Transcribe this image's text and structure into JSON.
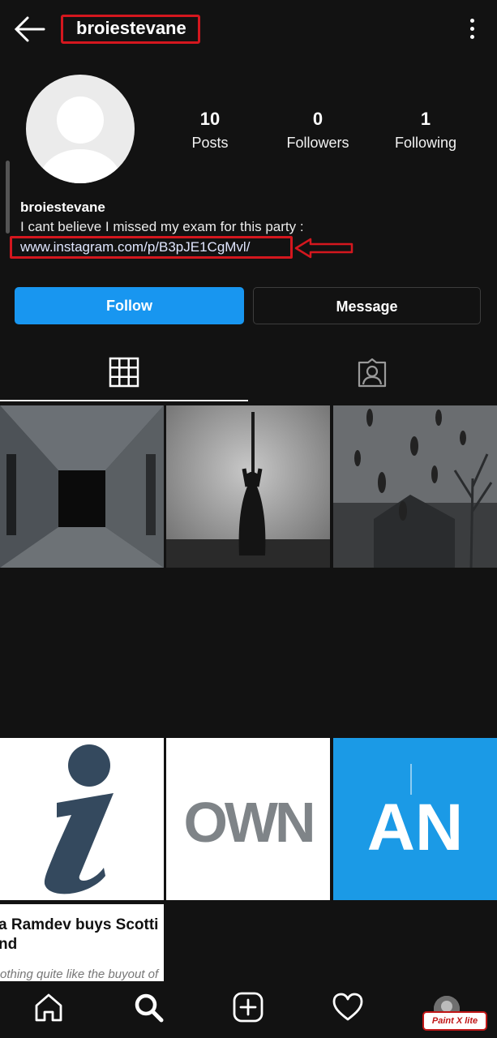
{
  "header": {
    "username": "broiestevane"
  },
  "stats": [
    {
      "value": "10",
      "label": "Posts"
    },
    {
      "value": "0",
      "label": "Followers"
    },
    {
      "value": "1",
      "label": "Following"
    }
  ],
  "bio": {
    "name": "broiestevane",
    "text": "I cant believe I missed my exam for this party :",
    "link": "www.instagram.com/p/B3pJE1CgMvl/"
  },
  "buttons": {
    "follow": "Follow",
    "message": "Message"
  },
  "tiles": {
    "own_text": "OWN",
    "an_text": "AN",
    "news_title_1": "a Ramdev buys Scotti",
    "news_title_2": "nd",
    "news_sub": "othing quite like the buyout of"
  },
  "watermark": "Paint X lite",
  "icons": [
    "back-arrow-icon",
    "more-vertical-icon",
    "grid-icon",
    "tagged-icon",
    "home-icon",
    "search-icon",
    "add-icon",
    "heart-icon"
  ],
  "colors": {
    "background": "#121212",
    "follow_button": "#1896f0",
    "annotation_red": "#d4171e"
  }
}
